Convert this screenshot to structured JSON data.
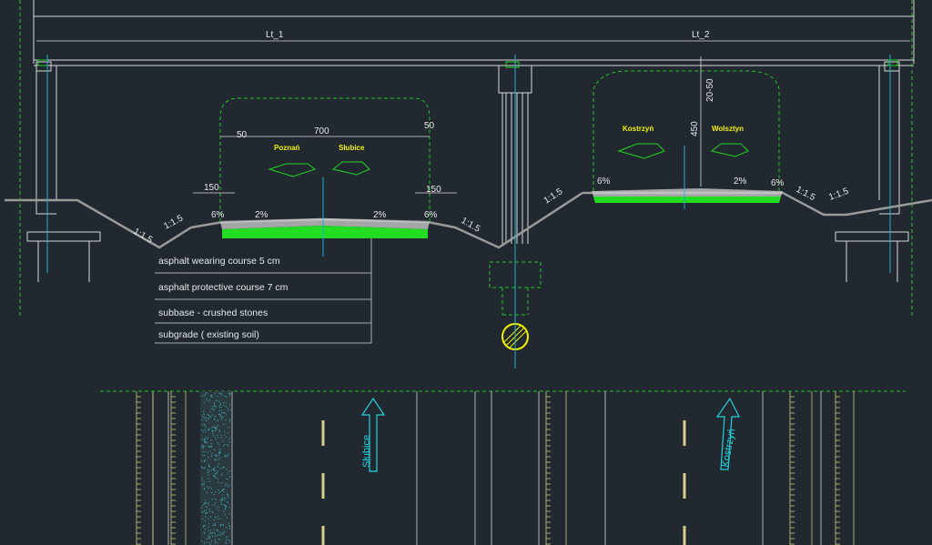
{
  "colors": {
    "background": "#212830",
    "line_white": "#d9d9d9",
    "line_green": "#1fd61f",
    "dashed_green": "#22c322",
    "text_yellow": "#f2f200",
    "text_cyan": "#22d3dc",
    "cyan_line": "#1fb0d0"
  },
  "dimensions": {
    "span_left": "Lt_1",
    "span_right": "Lt_2",
    "width_700": "700",
    "width_50_left": "50",
    "width_50_right": "50",
    "shoulder_150_left": "150",
    "shoulder_150_right": "150",
    "clearance_450": "450",
    "tolerance_20_50": "20-50"
  },
  "slopes": {
    "six_1": "6%",
    "two_1": "2%",
    "two_2": "2%",
    "six_2": "6%",
    "six_3": "6%",
    "two_3": "2%",
    "six_4": "6%",
    "embank_1": "1:1.5",
    "embank_2": "1:1.5",
    "embank_3": "1:1.5",
    "embank_4": "1:1.5",
    "embank_5": "1:1.5"
  },
  "vehicle_labels": {
    "poznan": "Poznań",
    "slubice_top": "Słubice",
    "kostrzyn_top": "Kostrzyń",
    "wolsztyn": "Wolsztyn"
  },
  "layers": [
    "asphalt wearing course 5 cm",
    "asphalt protective course 7 cm",
    "subbase - crushed stones",
    "subgrade  ( existing soil)"
  ],
  "plan_labels": {
    "slubice": "Słubice",
    "kostrzyn": "Kostrzyń"
  }
}
